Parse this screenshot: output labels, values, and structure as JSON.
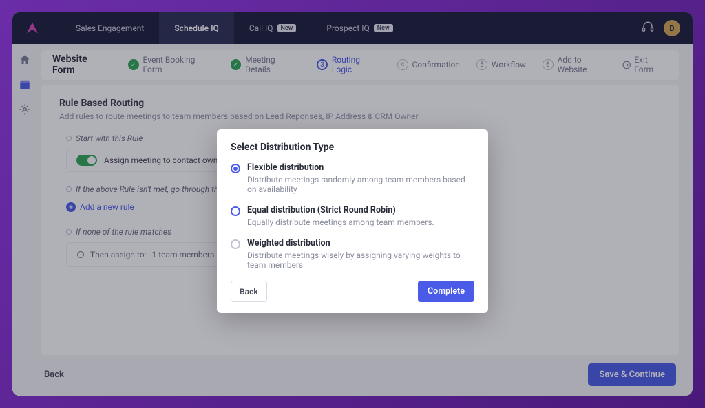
{
  "topbar": {
    "tabs": [
      {
        "label": "Sales Engagement"
      },
      {
        "label": "Schedule IQ"
      },
      {
        "label": "Call IQ",
        "badge": "New"
      },
      {
        "label": "Prospect IQ",
        "badge": "New"
      }
    ],
    "avatar_letter": "D"
  },
  "wizard": {
    "title": "Website Form",
    "steps": [
      {
        "label": "Event Booking Form",
        "state": "done"
      },
      {
        "label": "Meeting Details",
        "state": "done"
      },
      {
        "label": "Routing Logic",
        "state": "current",
        "num": "3"
      },
      {
        "label": "Confirmation",
        "num": "4"
      },
      {
        "label": "Workflow",
        "num": "5"
      },
      {
        "label": "Add to Website",
        "num": "6"
      }
    ],
    "exit": "Exit Form"
  },
  "content": {
    "title": "Rule Based Routing",
    "subtitle": "Add rules to route meetings to team members based on Lead Reponses, IP Address & CRM Owner",
    "rule1_label": "Start with this Rule",
    "toggle_label": "Assign meeting to contact owner",
    "rule2_label": "If the above Rule isn't met, go through the",
    "add_rule": "Add a new rule",
    "rule3_label": "If none of the rule matches",
    "then_assign_label": "Then assign to:",
    "then_assign_value": "1 team members"
  },
  "footer": {
    "back": "Back",
    "save": "Save & Continue"
  },
  "modal": {
    "title": "Select Distribution Type",
    "options": [
      {
        "title": "Flexible distribution",
        "desc": "Distribute meetings randomly among team members based on availability",
        "selected": true
      },
      {
        "title": "Equal distribution (Strict Round Robin)",
        "desc": "Equally distribute meetings among team members.",
        "selected": false
      },
      {
        "title": "Weighted distribution",
        "desc": "Distribute meetings wisely by assigning varying weights to team members",
        "selected": false
      }
    ],
    "back": "Back",
    "complete": "Complete"
  }
}
